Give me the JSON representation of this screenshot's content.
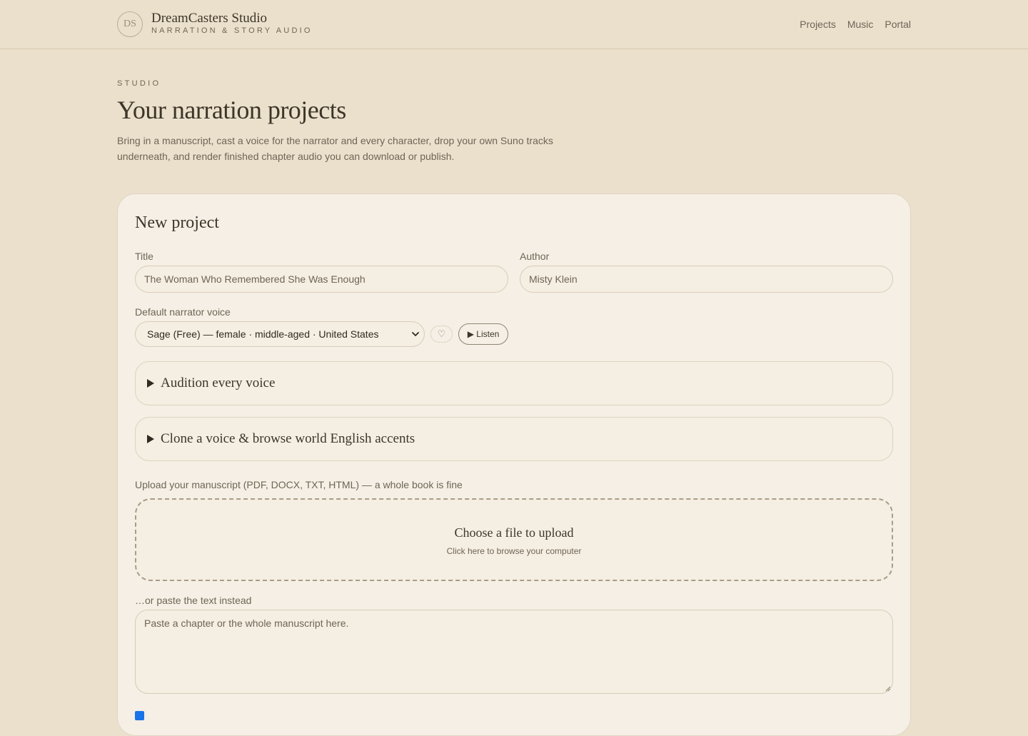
{
  "header": {
    "logo_initials": "DS",
    "brand_name": "DreamCasters Studio",
    "brand_tagline": "NARRATION & STORY AUDIO",
    "nav": [
      "Projects",
      "Music",
      "Portal"
    ]
  },
  "page": {
    "eyebrow": "STUDIO",
    "title": "Your narration projects",
    "intro": "Bring in a manuscript, cast a voice for the narrator and every character, drop your own Suno tracks underneath, and render finished chapter audio you can download or publish."
  },
  "new_project": {
    "heading": "New project",
    "title_label": "Title",
    "title_value": "The Woman Who Remembered She Was Enough",
    "author_label": "Author",
    "author_value": "Misty Klein",
    "voice_label": "Default narrator voice",
    "voice_selected": "Sage (Free) — female · middle-aged · United States",
    "favorite_icon": "♡",
    "listen_label": "▶ Listen",
    "sections": [
      "Audition every voice",
      "Clone a voice & browse world English accents"
    ],
    "upload_label": "Upload your manuscript (PDF, DOCX, TXT, HTML) — a whole book is fine",
    "upload_title": "Choose a file to upload",
    "upload_sub": "Click here to browse your computer",
    "paste_label": "…or paste the text instead",
    "paste_placeholder": "Paste a chapter or the whole manuscript here.",
    "split_checked": true
  },
  "colors": {
    "background": "#ebe0cc",
    "card": "#f5efe5",
    "text": "#3d3528",
    "muted": "#6f6555",
    "checkbox": "#1a73e8"
  }
}
